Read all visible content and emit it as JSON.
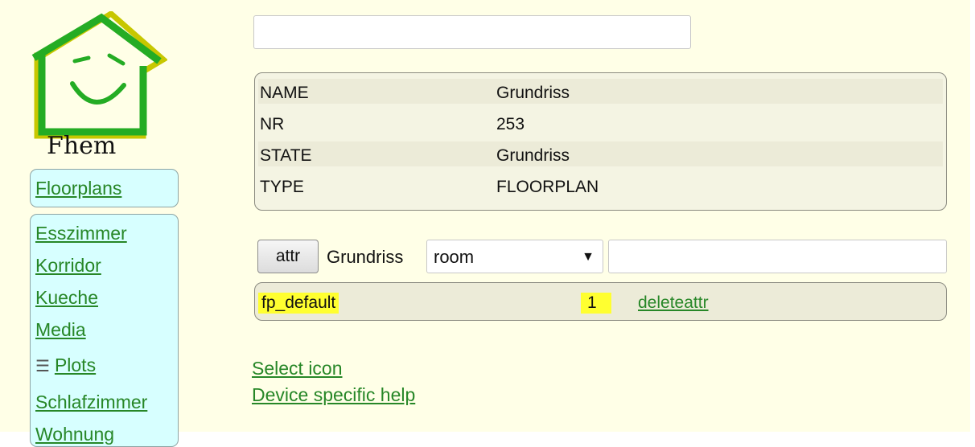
{
  "logo": {
    "text": "Fhem"
  },
  "menu": {
    "floorplans_label": "Floorplans",
    "rooms": [
      {
        "label": "Esszimmer"
      },
      {
        "label": "Korridor"
      },
      {
        "label": "Kueche"
      },
      {
        "label": "Media"
      },
      {
        "label": "Plots"
      },
      {
        "label": "Schlafzimmer"
      },
      {
        "label": "Wohnung"
      }
    ]
  },
  "top_input": {
    "value": ""
  },
  "internals": {
    "rows": [
      {
        "key": "NAME",
        "value": "Grundriss"
      },
      {
        "key": "NR",
        "value": "253"
      },
      {
        "key": "STATE",
        "value": "Grundriss"
      },
      {
        "key": "TYPE",
        "value": "FLOORPLAN"
      }
    ]
  },
  "attr_controls": {
    "button_label": "attr",
    "device_name": "Grundriss",
    "selected_attribute": "room",
    "value": ""
  },
  "attributes": [
    {
      "name": "fp_default",
      "value": "1",
      "delete_label": "deleteattr"
    }
  ],
  "links": {
    "select_icon": "Select icon",
    "device_help": "Device specific help"
  },
  "colors": {
    "page_background": "#ffffe7",
    "menu_background": "#d7ffff",
    "link": "#278727",
    "highlight": "#ffff30",
    "logo_green": "#24ac24",
    "logo_yellow": "#c7c700"
  },
  "icons": {
    "logo": "fhem-house-smiley-logo",
    "plots": "plots-icon",
    "select_arrow": "chevron-down-icon"
  }
}
